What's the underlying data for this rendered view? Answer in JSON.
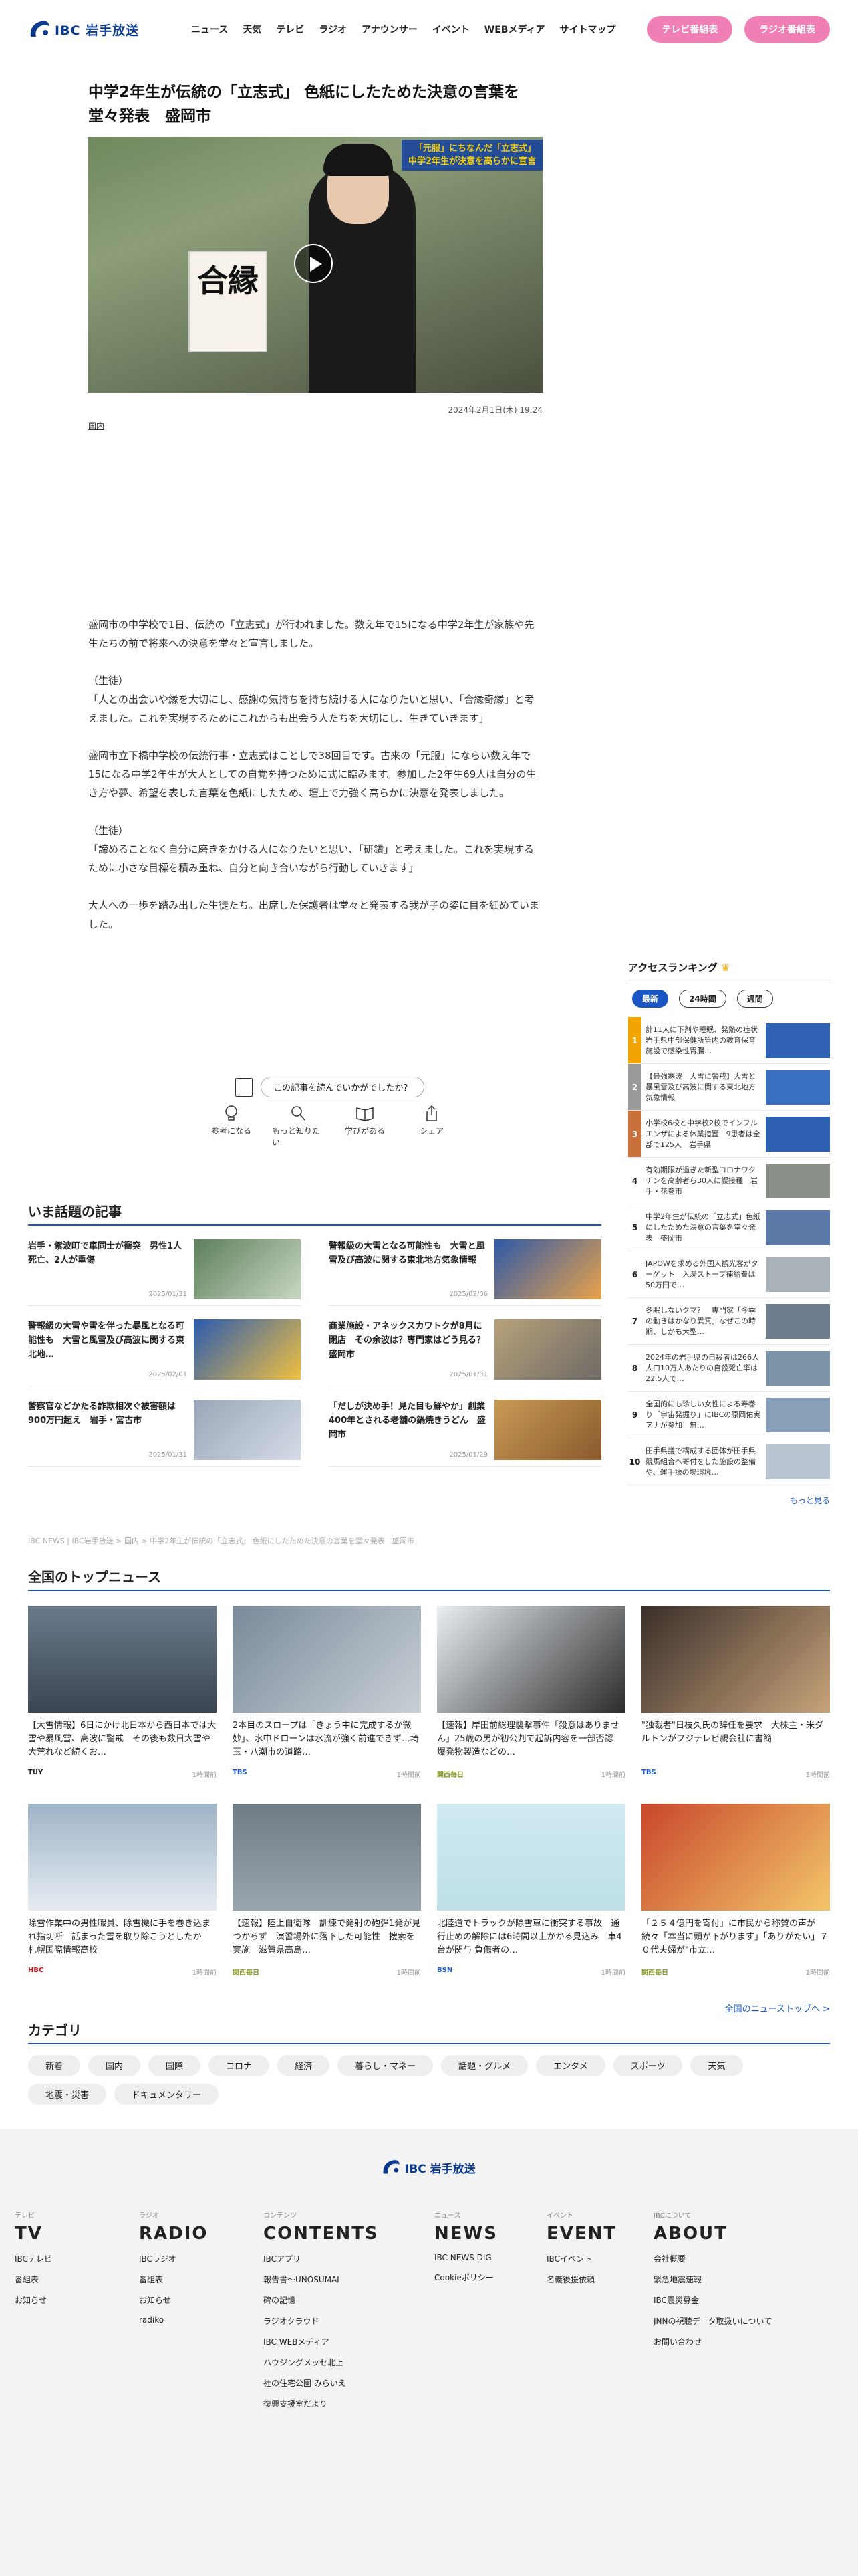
{
  "header": {
    "logo_text": "IBC 岩手放送",
    "nav": [
      "ニュース",
      "天気",
      "テレビ",
      "ラジオ",
      "アナウンサー",
      "イベント",
      "WEBメディア",
      "サイトマップ"
    ],
    "tv_btn": "テレビ番組表",
    "radio_btn": "ラジオ番組表"
  },
  "article": {
    "title": "中学2年生が伝統の「立志式」 色紙にしたためた決意の言葉を堂々発表　盛岡市",
    "video_caption_1": "「元服」にちなんだ「立志式」",
    "video_caption_2": "中学2年生が決意を高らかに宣言",
    "board_text": "合縁",
    "date": "2024年2月1日(木) 19:24",
    "category": "国内",
    "paragraphs": [
      "盛岡市の中学校で1日、伝統の「立志式」が行われました。数え年で15になる中学2年生が家族や先生たちの前で将来への決意を堂々と宣言しました。",
      "（生徒）\n「人との出会いや縁を大切にし、感謝の気持ちを持ち続ける人になりたいと思い、「合縁奇縁」と考えました。これを実現するためにこれからも出会う人たちを大切にし、生きていきます」",
      "盛岡市立下橋中学校の伝統行事・立志式はことしで38回目です。古来の「元服」にならい数え年で15になる中学2年生が大人としての自覚を持つために式に臨みます。参加した2年生69人は自分の生き方や夢、希望を表した言葉を色紙にしたため、壇上で力強く高らかに決意を発表しました。",
      "（生徒）\n「諦めることなく自分に磨きをかける人になりたいと思い、「研鑽」と考えました。これを実現するために小さな目標を積み重ね、自分と向き合いながら行動していきます」",
      "大人への一歩を踏み出した生徒たち。出席した保護者は堂々と発表する我が子の姿に目を細めていました。"
    ],
    "feedback_question": "この記事を読んでいかがでしたか？",
    "reactions": [
      "参考になる",
      "もっと知りたい",
      "学びがある",
      "シェア"
    ]
  },
  "ranking": {
    "title": "アクセスランキング",
    "tabs": [
      "最新",
      "24時間",
      "週間"
    ],
    "more": "もっと見る",
    "items": [
      {
        "rank": "1",
        "text": "計11人に下剤や睡眠、発熱の症状　岩手県中部保健所管内の教育保育施設で感染性胃腸…",
        "color": "#f2a400"
      },
      {
        "rank": "2",
        "text": "【最強寒波　大雪に警戒】大雪と暴風雪及び高波に関する東北地方気象情報",
        "color": "#9a9a9a"
      },
      {
        "rank": "3",
        "text": "小学校6校と中学校2校でインフルエンザによる休業措置　9患者は全部で125人　岩手県",
        "color": "#c8713a"
      },
      {
        "rank": "4",
        "text": "有効期限が過ぎた新型コロナワクチンを高齢者ら30人に誤接種　岩手・花巻市"
      },
      {
        "rank": "5",
        "text": "中学2年生が伝統の「立志式」色紙にしたためた決意の言葉を堂々発表　盛岡市"
      },
      {
        "rank": "6",
        "text": "JAPOWを求める外国人観光客がターゲット　入湯ストーブ補給費は50万円で…"
      },
      {
        "rank": "7",
        "text": "冬眠しないクマ？　専門家「今季の動きはかなり異質」なぜこの時期、しかも大型…"
      },
      {
        "rank": "8",
        "text": "2024年の岩手県の自殺者は266人　人口10万人あたりの自殺死亡率は22.5人で…"
      },
      {
        "rank": "9",
        "text": "全国的にも珍しい女性による寿巻り「宇宙発掘り」にIBCの原岡佑実アナが参加！無…"
      },
      {
        "rank": "10",
        "text": "田手県議で構成する団体が田手県競馬組合へ寄付をした施設の整備や、運手振の場環境…"
      }
    ]
  },
  "hot": {
    "title": "いま話題の記事",
    "items": [
      {
        "text": "岩手・紫波町で車同士が衝突　男性1人死亡、2人が重傷",
        "date": "2025/01/31"
      },
      {
        "text": "警報級の大雪となる可能性も　大雪と風雪及び高波に関する東北地方気象情報",
        "date": "2025/02/06"
      },
      {
        "text": "警報級の大雪や雪を伴った暴風となる可能性も　大雪と風雪及び高波に関する東北地…",
        "date": "2025/02/01"
      },
      {
        "text": "商業施設・アネックスカワトクが8月に閉店　その余波は？専門家はどう見る？　盛岡市",
        "date": "2025/01/31"
      },
      {
        "text": "警察官などかたる詐欺相次ぐ被害額は900万円超え　岩手・宮古市",
        "date": "2025/01/31"
      },
      {
        "text": "「だしが決め手！見た目も鮮やか」創業400年とされる老舗の鍋焼きうどん　盛岡市",
        "date": "2025/01/29"
      }
    ]
  },
  "crumb": "IBC NEWS | IBC岩手放送 > 国内 > 中学2年生が伝統の「立志式」 色紙にしたためた決意の言葉を堂々発表　盛岡市",
  "national": {
    "title": "全国のトップニュース",
    "more": "全国のニューストップへ >",
    "items": [
      {
        "text": "【大雪情報】6日にかけ北日本から西日本では大雪や暴風雪、高波に警戒　その後も数日大雪や大荒れなど続くお…",
        "src": "TUY",
        "ago": "1時間前"
      },
      {
        "text": "2本目のスロープは「きょう中に完成するか微妙」、水中ドローンは水流が強く前進できず…埼玉・八潮市の道路…",
        "src": "TBS",
        "ago": "1時間前"
      },
      {
        "text": "【速報】岸田前総理襲撃事件「殺意はありません」25歳の男が初公判で起訴内容を一部否認　爆発物製造などの…",
        "src": "関西毎日",
        "ago": "1時間前"
      },
      {
        "text": "\"独裁者\"日枝久氏の辞任を要求　大株主・米ダルトンがフジテレビ親会社に書簡",
        "src": "TBS",
        "ago": "1時間前"
      },
      {
        "text": "除雪作業中の男性職員、除雪機に手を巻き込まれ指切断　話まった雪を取り除こうとしたか　札幌国際情報高校",
        "src": "HBC",
        "ago": "1時間前"
      },
      {
        "text": "【速報】陸上自衛隊　訓練で発射の砲弾1発が見つからず　演習場外に落下した可能性　捜索を実施　滋賀県高島…",
        "src": "関西毎日",
        "ago": "1時間前"
      },
      {
        "text": "北陸道でトラックが除雪車に衝突する事故　通行止めの解除には6時間以上かかる見込み　車4台が関与 負傷者の…",
        "src": "BSN",
        "ago": "1時間前"
      },
      {
        "text": "「２５４億円を寄付」に市民から称賛の声が続々「本当に頭が下がります」「ありがたい」７０代夫婦が\"市立…",
        "src": "関西毎日",
        "ago": "1時間前"
      }
    ]
  },
  "categories": {
    "title": "カテゴリ",
    "items": [
      "新着",
      "国内",
      "国際",
      "コロナ",
      "経済",
      "暮らし・マネー",
      "話題・グルメ",
      "エンタメ",
      "スポーツ",
      "天気",
      "地震・災害",
      "ドキュメンタリー"
    ]
  },
  "footer": {
    "logo_text": "IBC 岩手放送",
    "cols": [
      {
        "sub": "テレビ",
        "big": "TV",
        "links": [
          "IBCテレビ",
          "番組表",
          "お知らせ"
        ]
      },
      {
        "sub": "ラジオ",
        "big": "RADIO",
        "links": [
          "IBCラジオ",
          "番組表",
          "お知らせ",
          "radiko"
        ]
      },
      {
        "sub": "コンテンツ",
        "big": "CONTENTS",
        "links": [
          "IBCアプリ",
          "報告書〜UNOSUMAI",
          "碑の記憶",
          "ラジオクラウド",
          "IBC WEBメディア",
          "ハウジングメッセ北上",
          "社の住宅公園 みらいえ",
          "復興支援室だより"
        ]
      },
      {
        "sub": "ニュース",
        "big": "NEWS",
        "links": [
          "IBC NEWS DIG",
          "Cookieポリシー"
        ]
      },
      {
        "sub": "イベント",
        "big": "EVENT",
        "links": [
          "IBCイベント",
          "名義後援依頼"
        ]
      },
      {
        "sub": "IBCについて",
        "big": "ABOUT",
        "links": [
          "会社概要",
          "緊急地震速報",
          "IBC震災募金",
          "JNNの視聴データ取扱いについて",
          "お問い合わせ"
        ]
      }
    ]
  },
  "colors": {
    "accent": "#1a56c4",
    "pink": "#f07fb5",
    "logo": "#0b3a8f"
  }
}
